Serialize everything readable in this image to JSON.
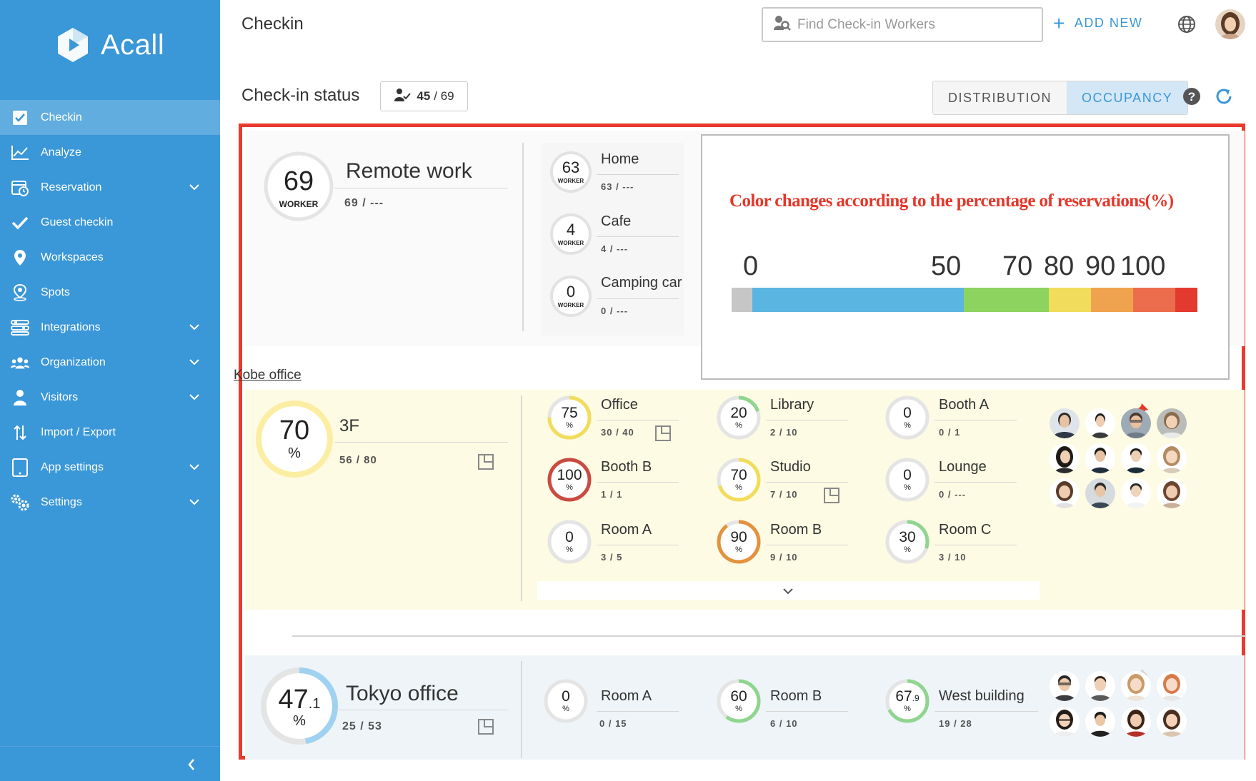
{
  "sidebar": {
    "brand": "Acall",
    "items": [
      {
        "label": "Checkin",
        "icon": "checkbox-icon",
        "active": true,
        "expandable": false
      },
      {
        "label": "Analyze",
        "icon": "chart-line-icon",
        "active": false,
        "expandable": false
      },
      {
        "label": "Reservation",
        "icon": "calendar-clock-icon",
        "active": false,
        "expandable": true
      },
      {
        "label": "Guest checkin",
        "icon": "check-icon",
        "active": false,
        "expandable": false
      },
      {
        "label": "Workspaces",
        "icon": "map-pin-icon",
        "active": false,
        "expandable": false
      },
      {
        "label": "Spots",
        "icon": "person-pin-icon",
        "active": false,
        "expandable": false
      },
      {
        "label": "Integrations",
        "icon": "sliders-icon",
        "active": false,
        "expandable": true
      },
      {
        "label": "Organization",
        "icon": "users-icon",
        "active": false,
        "expandable": true
      },
      {
        "label": "Visitors",
        "icon": "visitor-icon",
        "active": false,
        "expandable": true
      },
      {
        "label": "Import / Export",
        "icon": "import-export-icon",
        "active": false,
        "expandable": false
      },
      {
        "label": "App settings",
        "icon": "tablet-icon",
        "active": false,
        "expandable": true
      },
      {
        "label": "Settings",
        "icon": "gears-icon",
        "active": false,
        "expandable": true
      }
    ]
  },
  "header": {
    "title": "Checkin",
    "search_placeholder": "Find Check-in Workers",
    "add_new": "ADD NEW"
  },
  "status": {
    "label": "Check-in status",
    "checked": "45",
    "total": "/ 69",
    "tabs": [
      "DISTRIBUTION",
      "OCCUPANCY"
    ],
    "active_tab": "OCCUPANCY"
  },
  "remote": {
    "count": "69",
    "unit": "WORKER",
    "name": "Remote work",
    "sub": "69 / ---",
    "items": [
      {
        "count": "63",
        "unit": "WORKER",
        "name": "Home",
        "sub": "63 / ---"
      },
      {
        "count": "4",
        "unit": "WORKER",
        "name": "Cafe",
        "sub": "4 / ---"
      },
      {
        "count": "0",
        "unit": "WORKER",
        "name": "Camping car",
        "sub": "0 / ---"
      }
    ]
  },
  "legend": {
    "title": "Color changes according to the percentage of reservations(%)",
    "ticks": [
      "0",
      "50",
      "70",
      "80",
      "90",
      "100"
    ],
    "colors": [
      "#c6c6c6",
      "#5bb5e1",
      "#8dd35f",
      "#f2dc5b",
      "#f0a34e",
      "#ec6d4d",
      "#e33a2f"
    ]
  },
  "kobe": {
    "label": "Kobe office",
    "floor": {
      "value": "70",
      "unit": "%",
      "name": "3F",
      "sub": "56 / 80",
      "percent": 70
    },
    "spots": [
      {
        "value": "75",
        "unit": "%",
        "name": "Office",
        "sub": "30 / 40",
        "percent": 75,
        "color": "#f2dc5b"
      },
      {
        "value": "20",
        "unit": "%",
        "name": "Library",
        "sub": "2 / 10",
        "percent": 20,
        "color": "#8fd58f"
      },
      {
        "value": "0",
        "unit": "%",
        "name": "Booth A",
        "sub": "0 / 1",
        "percent": 0,
        "color": "#cccccc"
      },
      {
        "value": "100",
        "unit": "%",
        "name": "Booth B",
        "sub": "1 / 1",
        "percent": 100,
        "color": "#c94a40"
      },
      {
        "value": "70",
        "unit": "%",
        "name": "Studio",
        "sub": "7 / 10",
        "percent": 70,
        "color": "#f2dc5b"
      },
      {
        "value": "0",
        "unit": "%",
        "name": "Lounge",
        "sub": "0 / ---",
        "percent": 0,
        "color": "#cccccc"
      },
      {
        "value": "0",
        "unit": "%",
        "name": "Room A",
        "sub": "3 / 5",
        "percent": 0,
        "color": "#cccccc"
      },
      {
        "value": "90",
        "unit": "%",
        "name": "Room B",
        "sub": "9 / 10",
        "percent": 90,
        "color": "#e3923f"
      },
      {
        "value": "30",
        "unit": "%",
        "name": "Room C",
        "sub": "3 / 10",
        "percent": 30,
        "color": "#8fd58f"
      }
    ]
  },
  "tokyo": {
    "value": "47",
    "decimal": ".1",
    "unit": "%",
    "name": "Tokyo office",
    "sub": "25 / 53",
    "percent": 47.1,
    "spots": [
      {
        "value": "0",
        "decimal": "",
        "unit": "%",
        "name": "Room A",
        "sub": "0 / 15",
        "percent": 0,
        "color": "#cccccc"
      },
      {
        "value": "60",
        "decimal": "",
        "unit": "%",
        "name": "Room B",
        "sub": "6 / 10",
        "percent": 60,
        "color": "#8fd58f"
      },
      {
        "value": "67",
        "decimal": ".9",
        "unit": "%",
        "name": "West building",
        "sub": "19 / 28",
        "percent": 67.9,
        "color": "#8fd58f"
      }
    ]
  }
}
